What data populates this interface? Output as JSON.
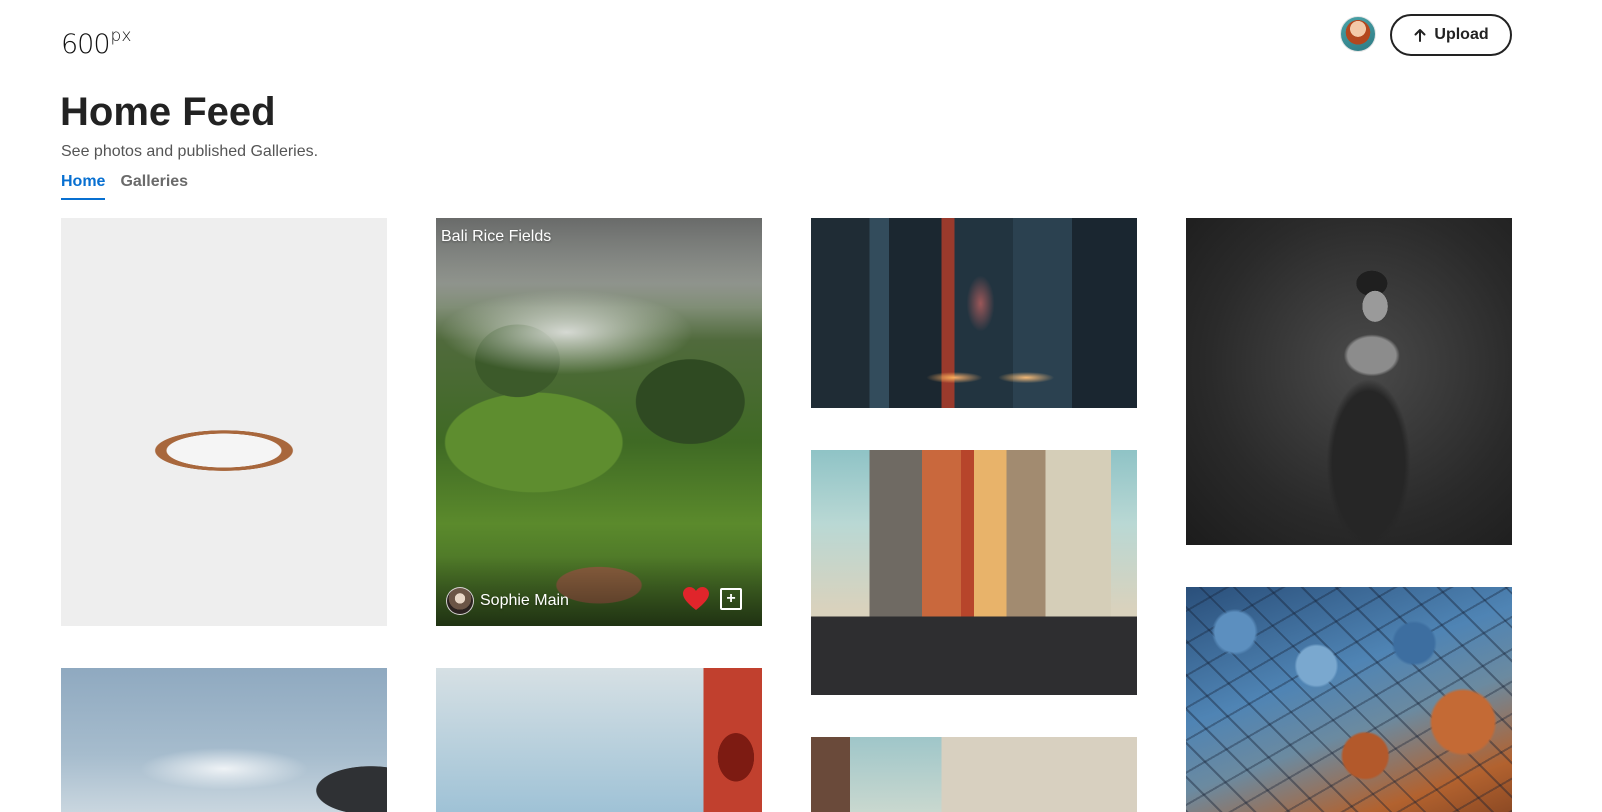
{
  "header": {
    "logo_text": "600",
    "logo_suffix": "px",
    "upload_label": "Upload"
  },
  "page": {
    "title": "Home Feed",
    "subtitle": "See photos and published Galleries."
  },
  "tabs": [
    {
      "label": "Home",
      "active": true
    },
    {
      "label": "Galleries",
      "active": false
    }
  ],
  "photos": {
    "featured": {
      "title": "Bali Rice Fields",
      "photographer": "Sophie Main",
      "liked": true
    }
  },
  "colors": {
    "accent": "#0870d1",
    "like": "#e0252b",
    "text": "#222222",
    "muted": "#6a6a6a"
  }
}
